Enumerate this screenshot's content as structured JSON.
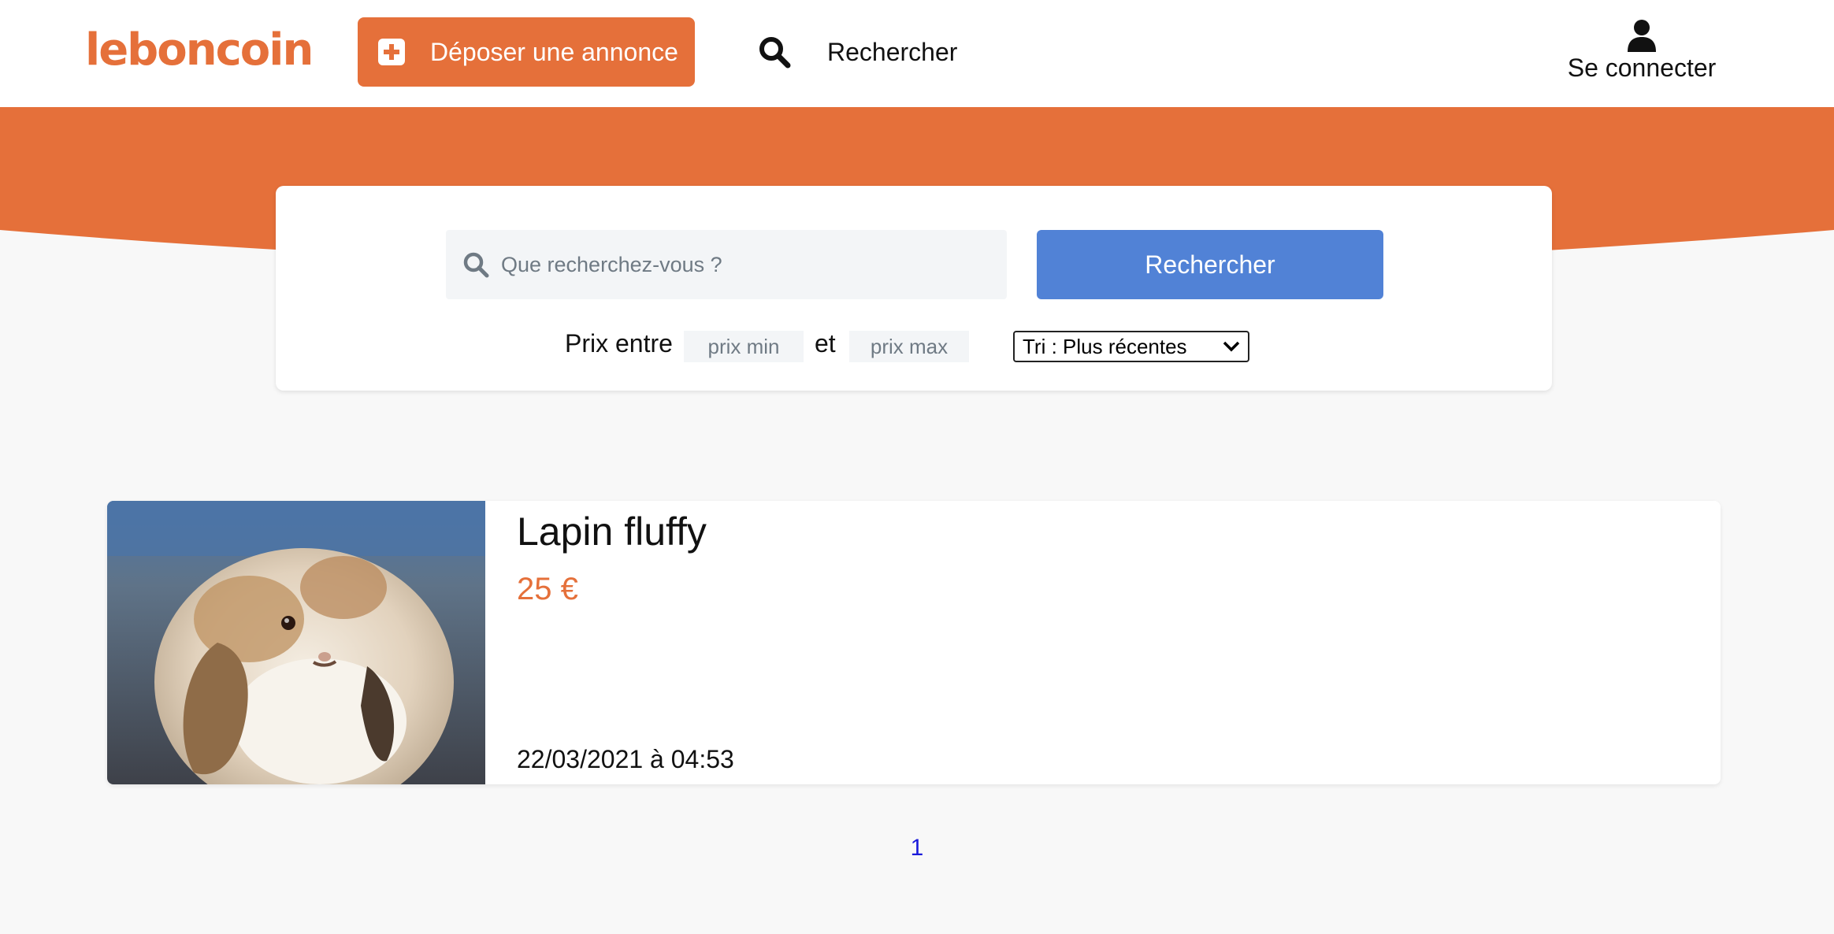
{
  "header": {
    "logo_text": "leboncoin",
    "post_button_label": "Déposer une annonce",
    "search_link_label": "Rechercher",
    "login_label": "Se connecter"
  },
  "search": {
    "placeholder": "Que recherchez-vous ?",
    "submit_label": "Rechercher",
    "price_prefix": "Prix entre",
    "price_min_placeholder": "prix min",
    "price_and": "et",
    "price_max_placeholder": "prix max",
    "sort_selected": "Tri : Plus récentes"
  },
  "listings": [
    {
      "title": "Lapin fluffy",
      "price": "25 €",
      "date": "22/03/2021 à 04:53",
      "image": "rabbit-photo"
    }
  ],
  "pagination": {
    "pages": [
      "1"
    ]
  },
  "colors": {
    "brand_orange": "#e5703a",
    "search_button_blue": "#5182d6",
    "page_background": "#f8f8f8",
    "link_blue": "#1a1adb"
  }
}
